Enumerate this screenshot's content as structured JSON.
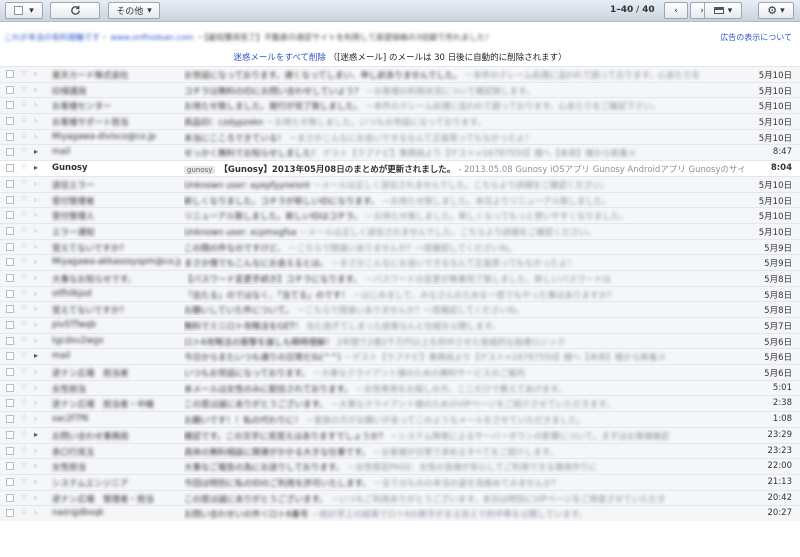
{
  "toolbar": {
    "more_label": "その他",
    "pager_range": "1–40",
    "pager_total": "40"
  },
  "ad": {
    "text_prefix": "これが本当の有料競輪です・",
    "text_sponsor": "www.onfhodsan.com",
    "text_body": "・【最短獲得見了】不動産の適定サイトを利用して高望価格の3倍額で売れました！",
    "link": "広告の表示について"
  },
  "notice": {
    "link": "迷惑メールをすべて削除",
    "text": "（[迷惑メール] のメールは 30 日後に自動的に削除されます）"
  },
  "emails": [
    {
      "sender": "楽天カード株式会社",
      "subject": "お世話になっております。遅くなってしまい、申し訳ありませんでした。",
      "snippet": "－本件のクレーム処理に追われて困っております。心あたりを",
      "date": "5月10日",
      "unread": false
    },
    {
      "sender": "ID保護局",
      "subject": "コチラは無料のIDにお問い合わせしていよう？",
      "snippet": "－お客様の利用状況について確認致します。",
      "date": "5月10日",
      "unread": false
    },
    {
      "sender": "お客様センター",
      "subject": "お待たせ致しました。発行が完了致しました。",
      "snippet": "－本件のクレーム処理に追われて困っております。心あたりをご確認下さい。",
      "date": "5月10日",
      "unread": false
    },
    {
      "sender": "お客様サポート担当",
      "subject": "商品ID：czdypzxkn",
      "snippet": "－お待たせ致しました。いつもお世話になっております。",
      "date": "5月10日",
      "unread": false
    },
    {
      "sender": "Miyagawa-divisco@co.jp",
      "subject": "本当にこころできている！",
      "snippet": "－まさかこんなにお会いできるなんて正直思ってもなかったよ！",
      "date": "5月10日",
      "unread": false
    },
    {
      "sender": "mail",
      "subject": "せっかく無料でお知らせしました！",
      "snippet": "ゲスト【ラブナビ】事務局より【ゲスト=16787550】様へ【本命】様から新着メ",
      "date": "8:47",
      "unread": false,
      "important": true
    },
    {
      "sender": "Gunosy",
      "label": "gunosy",
      "subject": "【Gunosy】2013年05月08日のまとめが更新されました。",
      "snippet": "- 2013.05.08 Gunosy iOSアプリ Gunosy Androidアプリ Gunosyのサイトで、",
      "date": "8:04",
      "unread": true,
      "important": true
    },
    {
      "sender": "送信エラー",
      "subject": "Unknown user: ayepfyyneisnt",
      "snippet": "－メールは正しく送信されませんでした。こちらより詳細をご確認ください。",
      "date": "5月10日",
      "unread": false
    },
    {
      "sender": "受付管理者",
      "subject": "新しくなりました。コチラが新しいIDになります。",
      "snippet": "－お待たせ致しました。本日よりリニューアル致しました。",
      "date": "5月10日",
      "unread": false
    },
    {
      "sender": "受付管理人",
      "subject": "リニューアル致しました。新しいIDはコチラ。",
      "snippet": "－お待たせ致しました。新しくなってもっと使いやすくなりました。",
      "date": "5月10日",
      "unread": false
    },
    {
      "sender": "エラー通知",
      "subject": "Unknown user: xcpmxgfsa",
      "snippet": "－メールは正しく送信されませんでした。こちらより詳細をご確認ください。",
      "date": "5月10日",
      "unread": false
    },
    {
      "sender": "覚えてないですか？",
      "subject": "この間の件なのですけど、",
      "snippet": "－こちらで間違いありませんか？一度確認してくださいね。",
      "date": "5月9日",
      "unread": false
    },
    {
      "sender": "Miyagawa-akkasosyspm@co.jp",
      "subject": "まさか僕でもこんなにお会えるとは。",
      "snippet": "－まさかこんなにお会いできるなんて正直思ってもなかったよ！",
      "date": "5月9日",
      "unread": false
    },
    {
      "sender": "大事なお知らせです。",
      "subject": "【パスワード変更手続き】コチラになります。",
      "snippet": "－パスワードの変更が無事完了致しました。新しいパスワードは",
      "date": "5月8日",
      "unread": false
    },
    {
      "sender": "otfhilkjod",
      "subject": "「出たる」のではなく、「当てる」のです！",
      "snippet": "－はじめまして。みなさんのためを一度でもやった事はありますか？",
      "date": "5月8日",
      "unread": false
    },
    {
      "sender": "覚えてないですか？",
      "subject": "お願いしていた件について。",
      "snippet": "－こちらで間違いありませんか？一度確認してくださいね。",
      "date": "5月8日",
      "unread": false
    },
    {
      "sender": "pivSTfwqb",
      "subject": "無料でミニロト攻略法をGET！",
      "snippet": "当た過ぎてしまった結果なんと仕組を公開します。",
      "date": "5月7日",
      "unread": false
    },
    {
      "sender": "tgcdxv2wgx",
      "subject": "ロト6攻略法の衝撃を誰しも瞬時理解！",
      "snippet": "2年間で2億2千万円以上を的中させた脅威的な指導ロジック",
      "date": "5月6日",
      "unread": false
    },
    {
      "sender": "mail",
      "subject": "今日からまたいつも通りの日常だね(^^)",
      "snippet": "－ゲスト【ラブナビ】事務局より【ゲスト=16787550】様へ【本命】様から新着メ",
      "date": "5月6日",
      "unread": false,
      "important": true
    },
    {
      "sender": "逆ナン広場　担当者",
      "subject": "いつもお世話になっております。",
      "snippet": "－大事なクライアント様のための無料サービスのご案内",
      "date": "5月6日",
      "unread": false
    },
    {
      "sender": "女性担当",
      "subject": "本メールは女性のみに配信されております。",
      "snippet": "－女性専用をお探しの方、ここだけで教えてあげます。",
      "date": "5:01",
      "unread": false
    },
    {
      "sender": "逆ナン広場　担当者・中継",
      "subject": "この度は誠にありがとうございます。",
      "snippet": "－大事なクライアント様のためのVIPページをご紹介させていただきます。",
      "date": "2:38",
      "unread": false
    },
    {
      "sender": "sac2f7f6",
      "subject": "お願いです！！私の代わりに！",
      "snippet": "－家族の方がお願いがあってこのようなメールをさせていただきました。",
      "date": "1:08",
      "unread": false
    },
    {
      "sender": "お問い合わせ事務局",
      "subject": "確認です。この文字に見覚えはありますでしょうか？",
      "snippet": "－システム障害によるサーバーダウンの影響について。まずはお客様確認",
      "date": "23:29",
      "unread": false,
      "important": true
    },
    {
      "sender": "赤口行見玉",
      "subject": "具体の無料相談に関連がかかる大きな仕事です。",
      "snippet": "－お客様が日常で求めるすべてをご紹介します。",
      "date": "23:23",
      "unread": false
    },
    {
      "sender": "女性担当",
      "subject": "大事なご報告の為にお送りしております。",
      "snippet": "－女性限定PASS：女性の皆様が安心してご利用できる環境作りに",
      "date": "22:00",
      "unread": false
    },
    {
      "sender": "システムエンジニア",
      "subject": "今回は特別に私のIDのご利用を許可いたします。",
      "snippet": "－全てのものの本当の姿を見極めてみませんか？",
      "date": "21:13",
      "unread": false
    },
    {
      "sender": "逆ナン広場　管理者・担当",
      "subject": "この度は誠にありがとうございます。",
      "snippet": "－いつもご利用ありがとうございます。本日は特別にVIPページをご用意させていただき",
      "date": "20:42",
      "unread": false
    },
    {
      "sender": "nazrqjdbsqk",
      "subject": "お問い合わせいの件＜ロト6番号",
      "snippet": "－統計学上の結果でロト6の数字がまる見えで的中率を公開しています。",
      "date": "20:27",
      "unread": false
    }
  ]
}
